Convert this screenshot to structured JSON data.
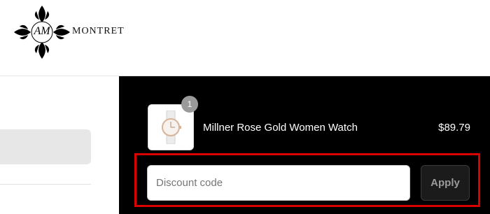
{
  "header": {
    "brand_name": "MONTRET",
    "logo_monogram": "AM"
  },
  "order_summary": {
    "item": {
      "quantity": "1",
      "name": "Millner Rose Gold Women Watch",
      "price": "$89.79",
      "thumbnail_icon": "watch-icon"
    },
    "discount": {
      "placeholder": "Discount code",
      "value": "",
      "apply_label": "Apply"
    },
    "highlight_color": "#d90000"
  },
  "colors": {
    "summary_background": "#000000",
    "left_field": "#e7e7e7"
  }
}
